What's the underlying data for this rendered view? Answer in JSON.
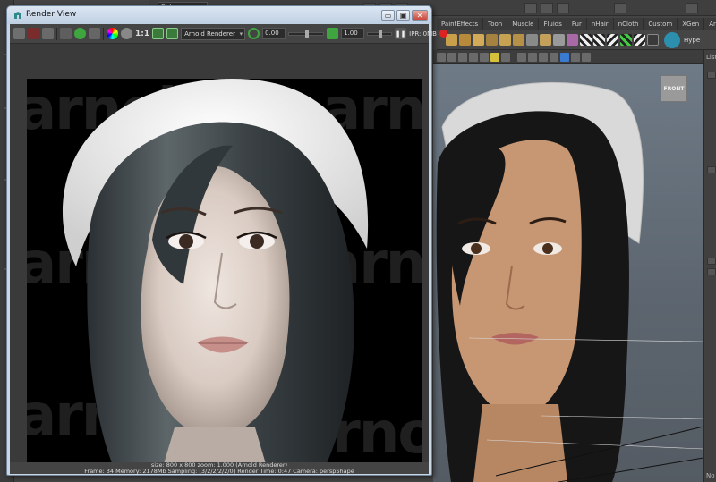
{
  "window": {
    "title": "Render View",
    "min_glyph": "▭",
    "max_glyph": "▣",
    "close_glyph": "✕"
  },
  "maya": {
    "mode_select": "Polygons",
    "shelf_tabs": [
      "PaintEffects",
      "Toon",
      "Muscle",
      "Fluids",
      "Fur",
      "nHair",
      "nCloth",
      "Custom",
      "XGen",
      "Arnold"
    ],
    "shelf_extra_label": "Hype",
    "viewcube_label": "FRONT",
    "list_label": "List",
    "no_label": "No"
  },
  "render_toolbar": {
    "ratio_label": "1:1",
    "renderer": "Arnold Renderer",
    "exposure": "0.00",
    "gamma": "1.00",
    "ipr_label": "IPR: 0MB"
  },
  "render_image": {
    "watermark_word": "arnold"
  },
  "status": {
    "line1": "size: 800 x 800  zoom: 1.000     (Arnold Renderer)",
    "line2": "Frame: 34    Memory: 2178Mb    Sampling: [3/2/2/2/2/0]    Render Time: 0:47    Camera: perspShape"
  },
  "colors": {
    "accent_green": "#3fa63f",
    "close_red": "#c9473a",
    "hype_teal": "#2c8fae"
  }
}
